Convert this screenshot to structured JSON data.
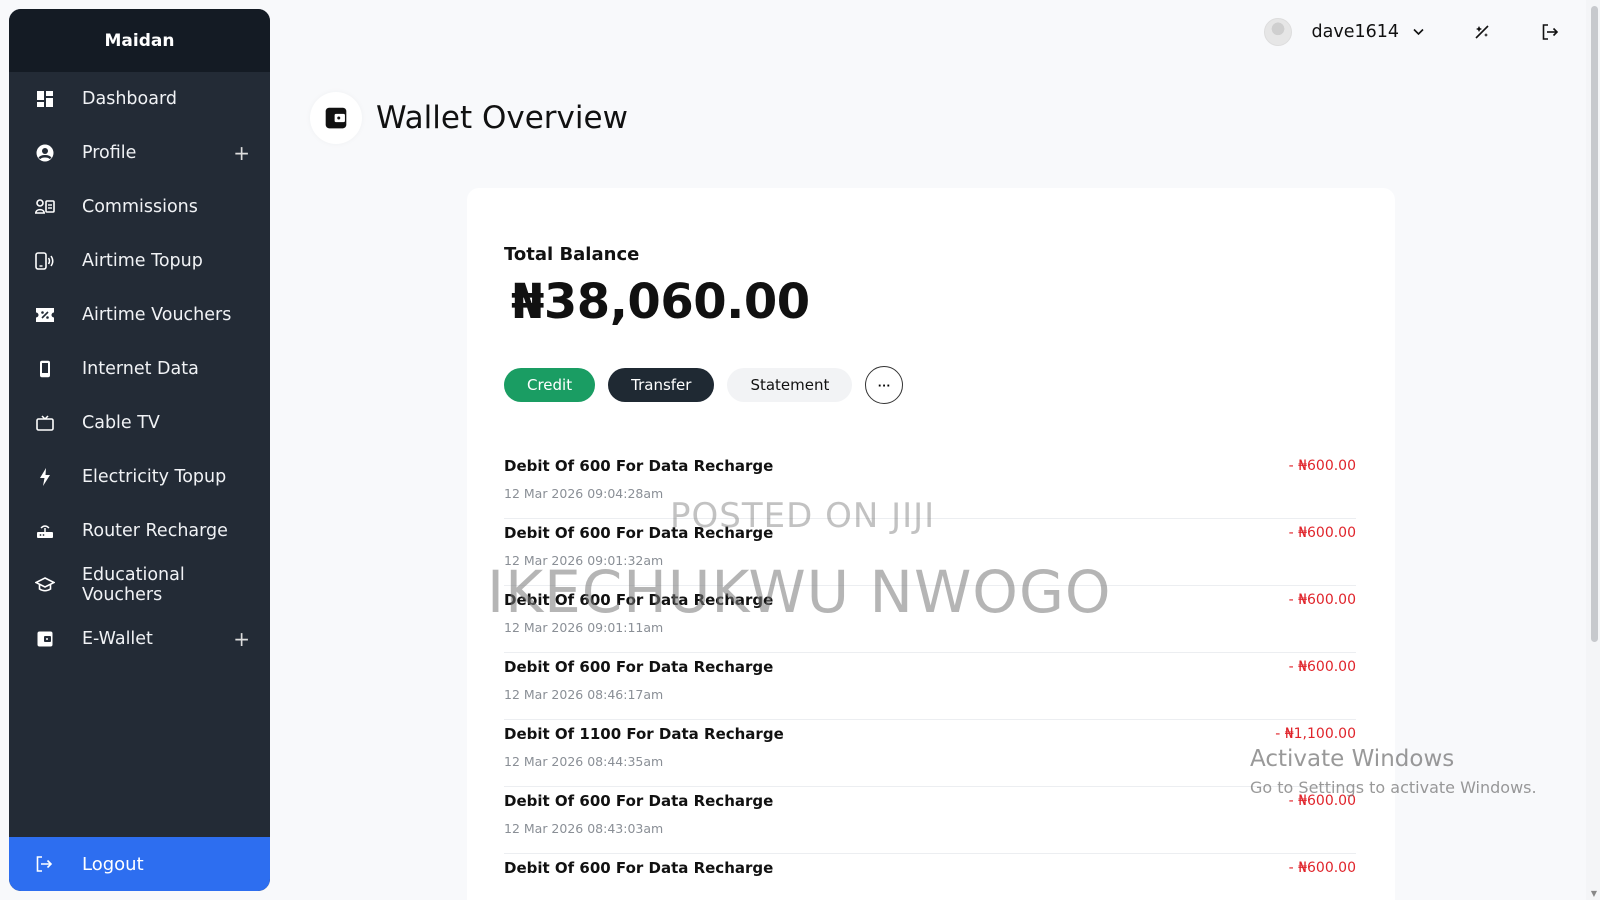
{
  "app": {
    "brand": "Maidan"
  },
  "sidebar": {
    "items": [
      {
        "label": "Dashboard",
        "icon": "dashboard-icon",
        "expandable": false
      },
      {
        "label": "Profile",
        "icon": "user-circle-icon",
        "expandable": true
      },
      {
        "label": "Commissions",
        "icon": "commissions-icon",
        "expandable": false
      },
      {
        "label": "Airtime Topup",
        "icon": "phone-signal-icon",
        "expandable": false
      },
      {
        "label": "Airtime Vouchers",
        "icon": "voucher-icon",
        "expandable": false
      },
      {
        "label": "Internet Data",
        "icon": "mobile-icon",
        "expandable": false
      },
      {
        "label": "Cable TV",
        "icon": "tv-icon",
        "expandable": false
      },
      {
        "label": "Electricity Topup",
        "icon": "lightning-icon",
        "expandable": false
      },
      {
        "label": "Router Recharge",
        "icon": "router-icon",
        "expandable": false
      },
      {
        "label": "Educational Vouchers",
        "icon": "graduation-cap-icon",
        "expandable": false
      },
      {
        "label": "E-Wallet",
        "icon": "wallet-icon",
        "expandable": true
      }
    ],
    "expand_symbol": "+",
    "logout_label": "Logout"
  },
  "header": {
    "username": "dave1614"
  },
  "page": {
    "title": "Wallet Overview"
  },
  "wallet": {
    "balance_label": "Total Balance",
    "balance": "₦38,060.00",
    "actions": {
      "credit": "Credit",
      "transfer": "Transfer",
      "statement": "Statement",
      "more": "···"
    }
  },
  "transactions": [
    {
      "title": "Debit Of 600 For Data Recharge",
      "date": "12 Mar 2026 09:04:28am",
      "amount": "- ₦600.00"
    },
    {
      "title": "Debit Of 600 For Data Recharge",
      "date": "12 Mar 2026 09:01:32am",
      "amount": "- ₦600.00"
    },
    {
      "title": "Debit Of 600 For Data Recharge",
      "date": "12 Mar 2026 09:01:11am",
      "amount": "- ₦600.00"
    },
    {
      "title": "Debit Of 600 For Data Recharge",
      "date": "12 Mar 2026 08:46:17am",
      "amount": "- ₦600.00"
    },
    {
      "title": "Debit Of 1100 For Data Recharge",
      "date": "12 Mar 2026 08:44:35am",
      "amount": "- ₦1,100.00"
    },
    {
      "title": "Debit Of 600 For Data Recharge",
      "date": "12 Mar 2026 08:43:03am",
      "amount": "- ₦600.00"
    },
    {
      "title": "Debit Of 600 For Data Recharge",
      "date": "",
      "amount": "- ₦600.00"
    }
  ],
  "overlays": {
    "watermark_line1": "POSTED ON JIJI",
    "watermark_line2": "IKECHUKWU NWOGO",
    "activate_title": "Activate Windows",
    "activate_sub": "Go to Settings to activate Windows."
  },
  "colors": {
    "sidebar_bg": "#232b36",
    "brand_bg": "#141b24",
    "logout_bg": "#2d6ef0",
    "credit_btn": "#1a9d63",
    "transfer_btn": "#1f2933",
    "debit_amount": "#e0242b"
  }
}
